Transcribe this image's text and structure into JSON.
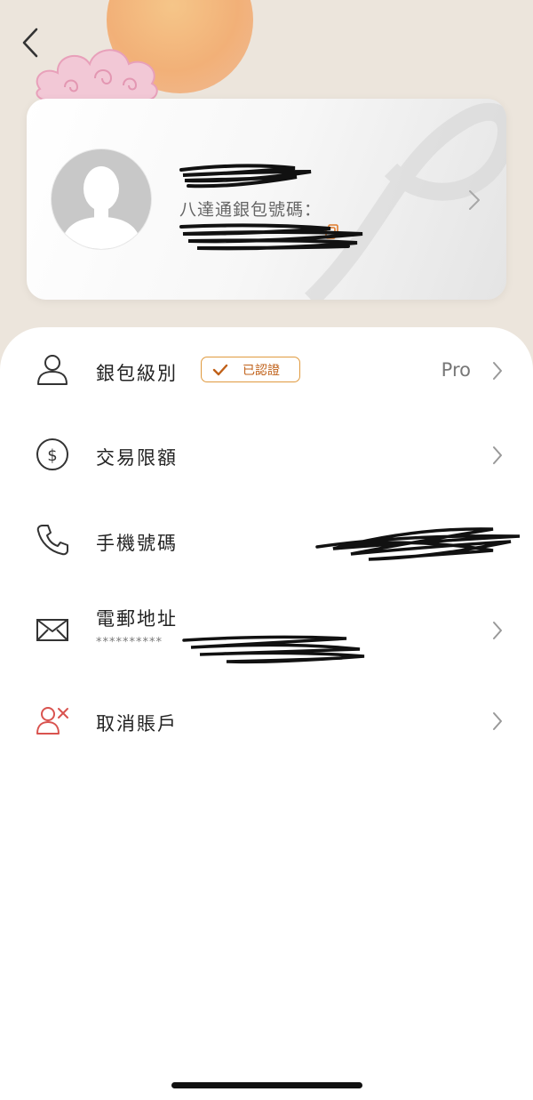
{
  "card": {
    "wallet_label": "八達通銀包號碼："
  },
  "menu": {
    "wallet_level": {
      "label": "銀包級別",
      "badge": "已認證",
      "value": "Pro"
    },
    "transaction_limit": {
      "label": "交易限額"
    },
    "phone": {
      "label": "手機號碼"
    },
    "email": {
      "label": "電郵地址",
      "masked": "**********"
    },
    "cancel_account": {
      "label": "取消賬戶"
    }
  },
  "icons": {
    "back": "back-chevron-icon",
    "avatar": "user-avatar-icon",
    "copy": "copy-icon",
    "level": "person-icon",
    "limit": "dollar-circle-icon",
    "phone": "phone-icon",
    "email": "envelope-icon",
    "cancel": "user-remove-icon"
  },
  "colors": {
    "accent": "#e09a3f",
    "badge_text": "#c06018",
    "cancel_icon": "#d9534f",
    "header_bg": "#ece5dc"
  }
}
